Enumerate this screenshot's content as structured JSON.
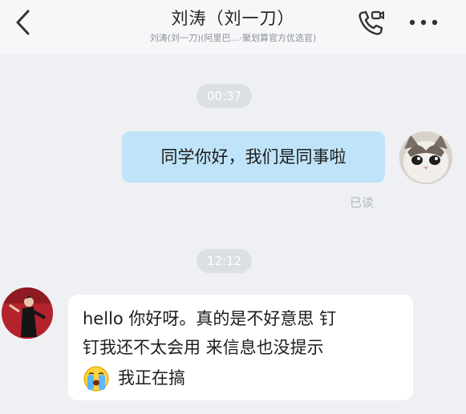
{
  "header": {
    "title": "刘涛（刘一刀）",
    "subtitle": "刘涛(刘一刀)(阿里巴...-聚划算官方优选官)",
    "back_icon": "chevron-left-icon",
    "call_icon": "phone-call-icon",
    "more_icon": "more-dots-icon"
  },
  "messages": [
    {
      "type": "time",
      "text": "00:37"
    },
    {
      "type": "outgoing",
      "text": "同学你好，我们是同事啦",
      "status": "已读"
    },
    {
      "type": "time",
      "text": "12:12"
    },
    {
      "type": "incoming",
      "lines": [
        "hello 你好呀。真的是不好意思 钉",
        "钉我还不太会用 来信息也没提示"
      ],
      "emoji": "crying-face-emoji",
      "tail": "我正在搞"
    }
  ],
  "colors": {
    "outgoing_bubble": "#bfe3f8",
    "incoming_bubble": "#ffffff",
    "background": "#eef0f3"
  }
}
